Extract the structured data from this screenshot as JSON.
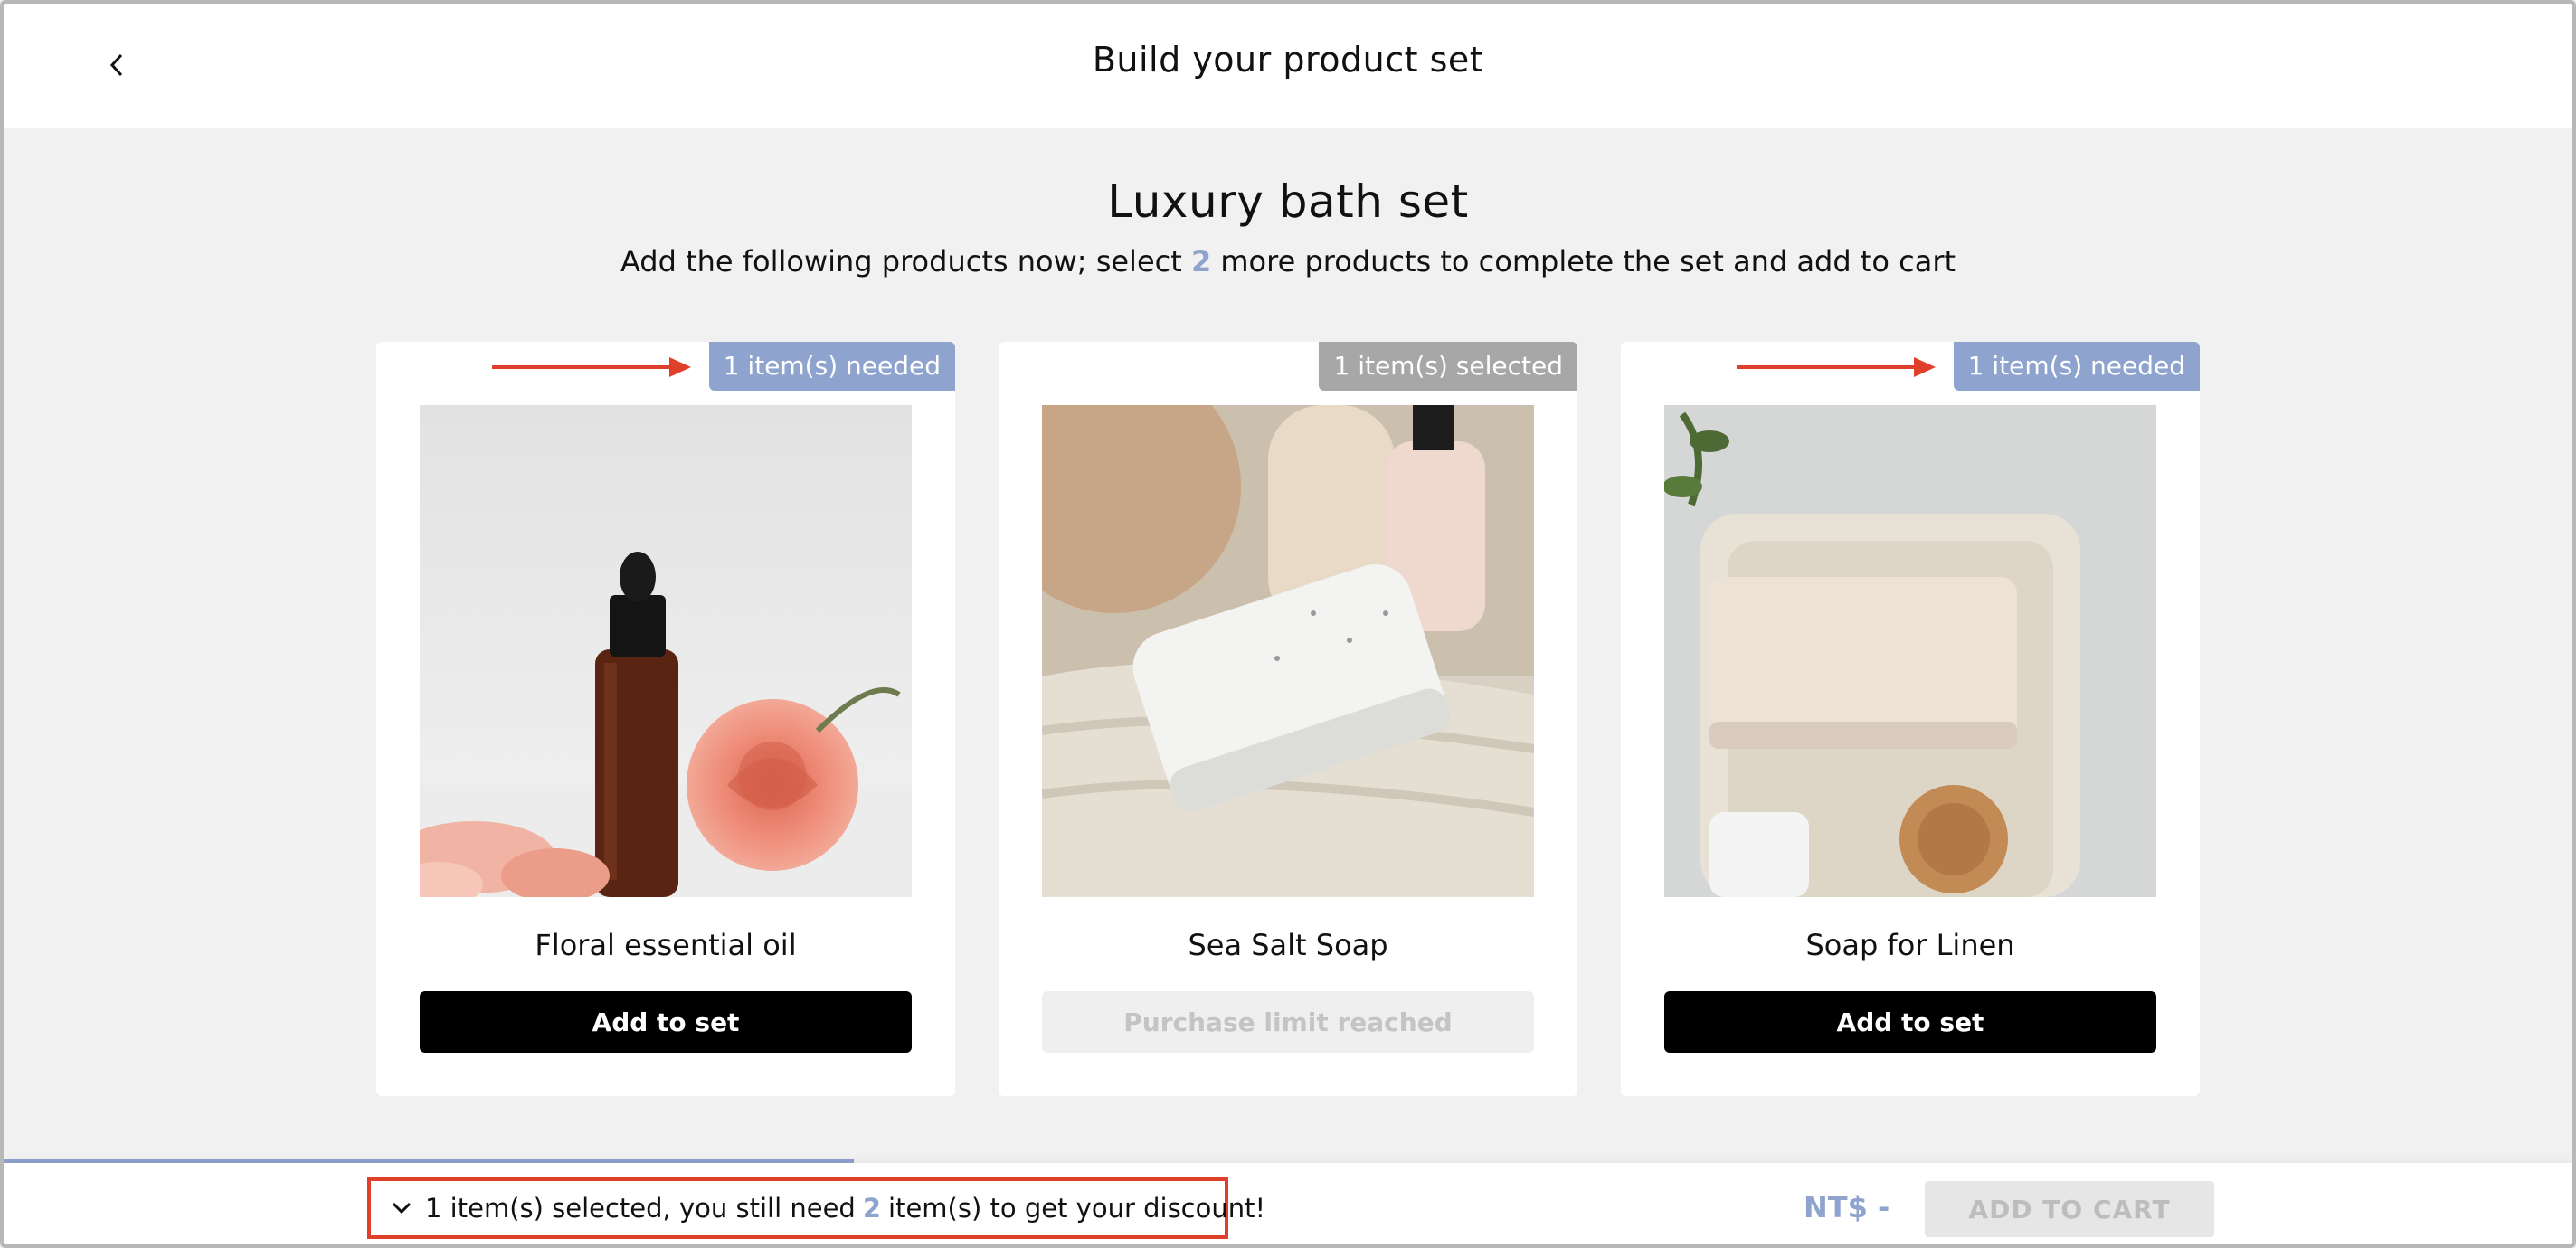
{
  "header": {
    "title": "Build your product set",
    "back_icon": "chevron-left-icon"
  },
  "set": {
    "title": "Luxury bath set",
    "subtitle_prefix": "Add the following products now; select ",
    "subtitle_count": "2",
    "subtitle_suffix": " more products to complete the set and add to cart"
  },
  "products": [
    {
      "name": "Floral essential oil",
      "badge": "1 item(s) needed",
      "badge_state": "needed",
      "button": "Add to set",
      "button_state": "active"
    },
    {
      "name": "Sea Salt Soap",
      "badge": "1 item(s) selected",
      "badge_state": "selected",
      "button": "Purchase limit reached",
      "button_state": "disabled"
    },
    {
      "name": "Soap for Linen",
      "badge": "1 item(s) needed",
      "badge_state": "needed",
      "button": "Add to set",
      "button_state": "active"
    }
  ],
  "footer": {
    "status_prefix": "1 item(s) selected, you still need ",
    "status_count": "2",
    "status_suffix": " item(s) to get your discount!",
    "price": "NT$ -",
    "cart_button": "ADD TO CART",
    "progress_fraction": 0.33
  },
  "colors": {
    "accent": "#8fa3cf",
    "badge_selected": "#a7a7a7",
    "annotation_red": "#e0402a"
  }
}
